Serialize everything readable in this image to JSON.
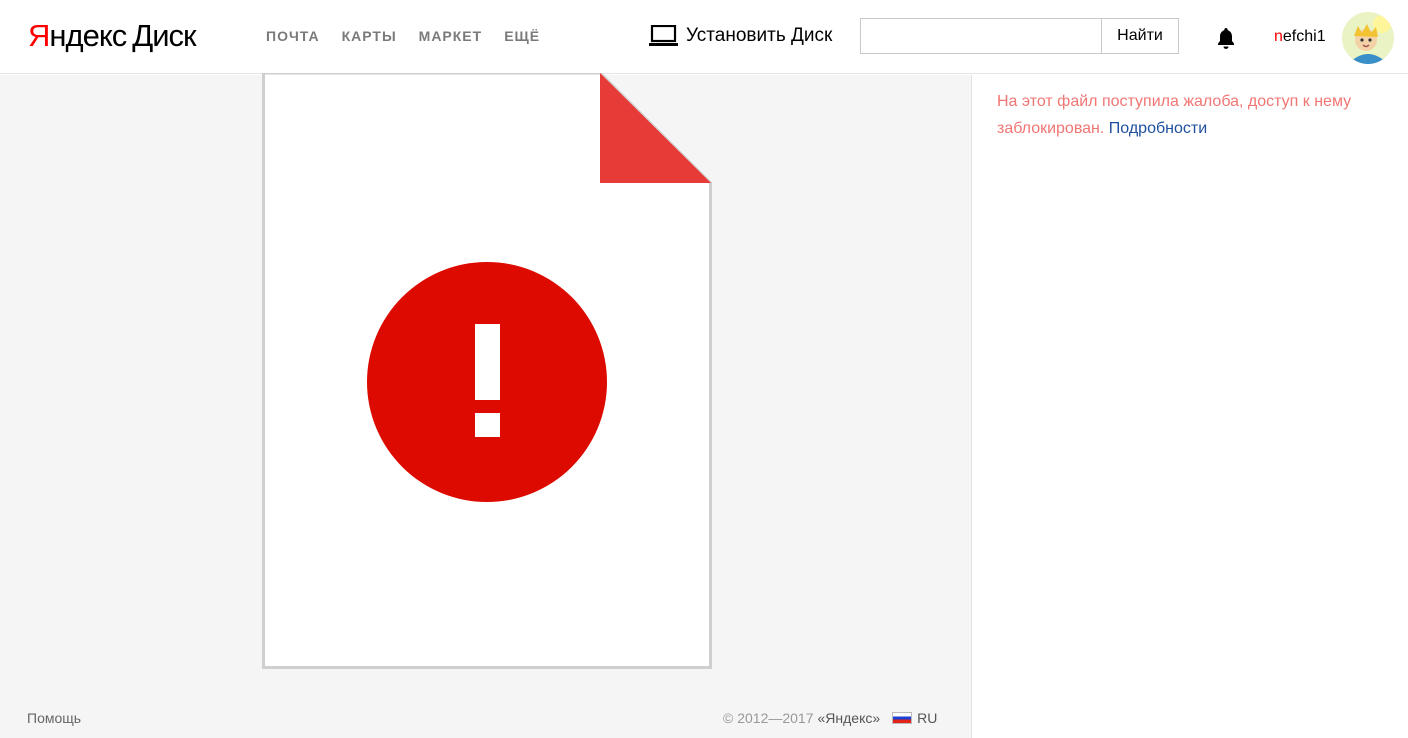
{
  "header": {
    "logo": {
      "ya": "Я",
      "ya_rest": "ндекс",
      "product": "Диск"
    },
    "nav": [
      "ПОЧТА",
      "КАРТЫ",
      "МАРКЕТ",
      "ЕЩЁ"
    ],
    "install_label": "Установить Диск",
    "search": {
      "value": "",
      "placeholder": "",
      "button_label": "Найти"
    },
    "user": {
      "first_letter": "n",
      "rest": "efchi1"
    }
  },
  "message": {
    "text": "На этот файл поступила жалоба, доступ к нему заблокирован.",
    "link": "Подробности"
  },
  "footer": {
    "help": "Помощь",
    "copyright": "© 2012—2017",
    "company": "«Яндекс»",
    "lang": "RU"
  },
  "colors": {
    "error_red": "#dd0a00",
    "corner_red": "#e63b37",
    "message_red": "#f07674",
    "link_blue": "#1f4f9e"
  },
  "icons": [
    "laptop-icon",
    "bell-icon",
    "warning-icon",
    "flag-ru-icon"
  ]
}
